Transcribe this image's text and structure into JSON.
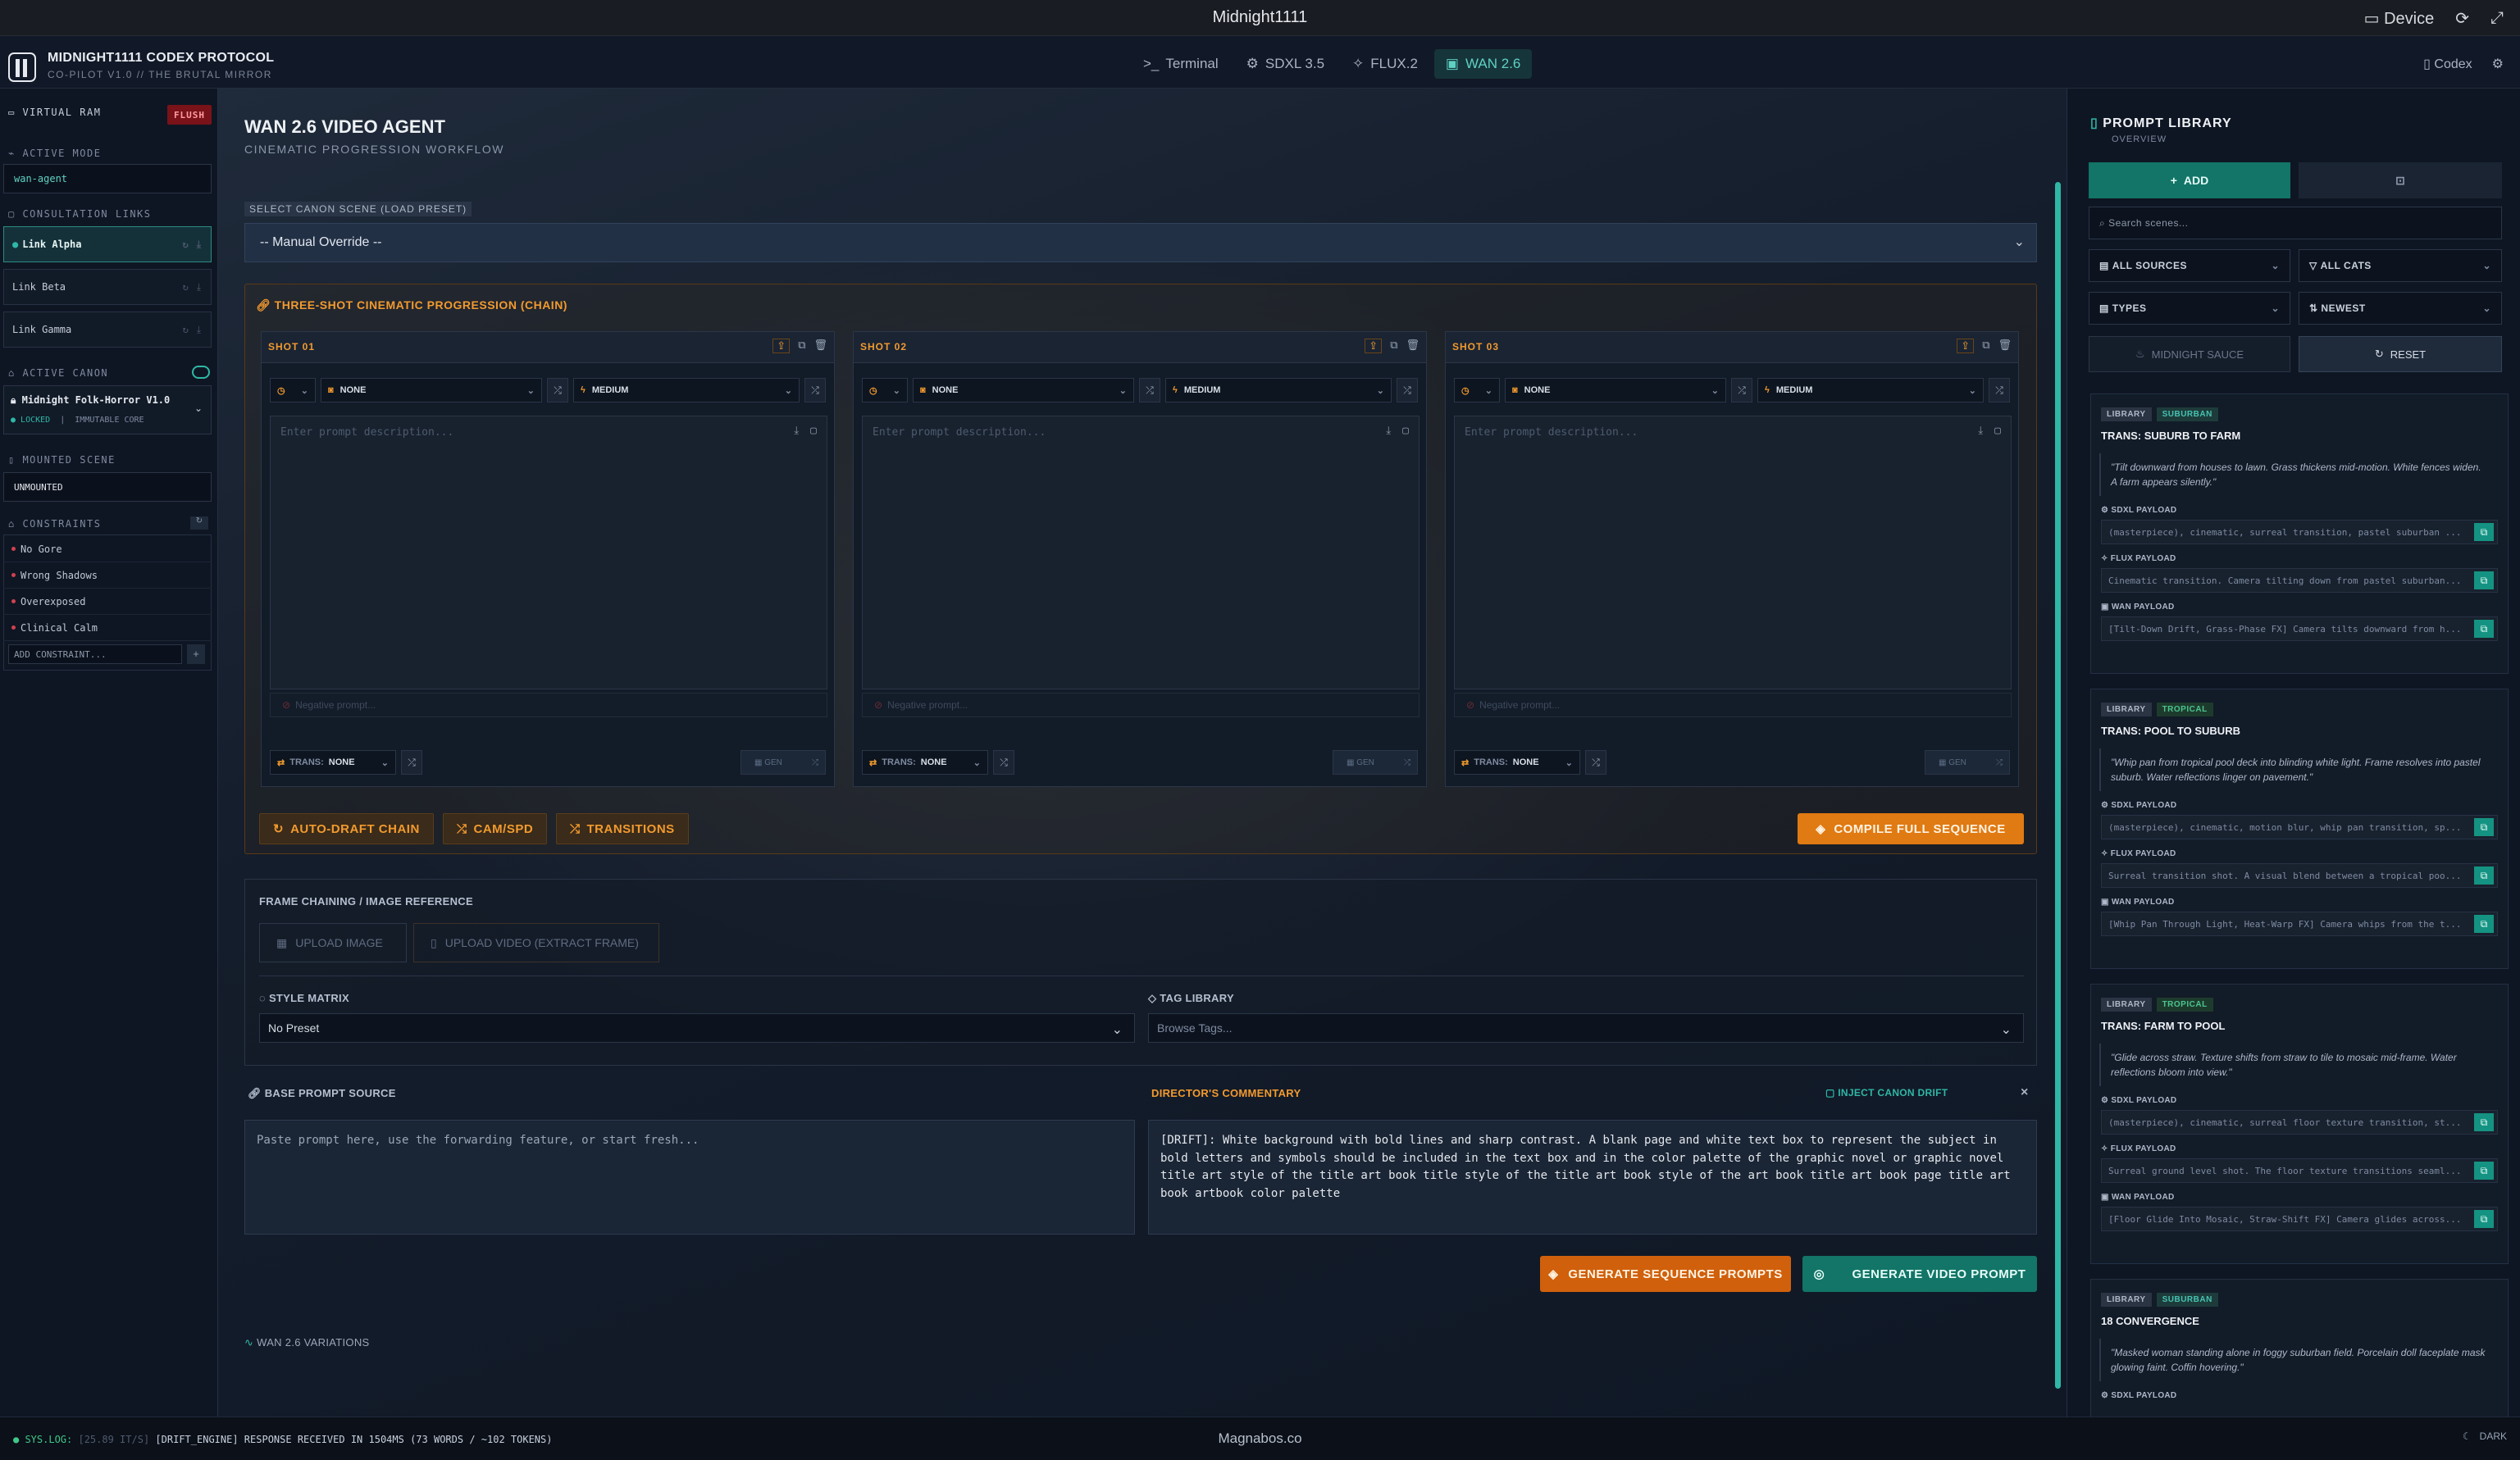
{
  "window": {
    "title": "Midnight1111",
    "device_label": "Device"
  },
  "brand": {
    "title": "MIDNIGHT1111 CODEX PROTOCOL",
    "subtitle": "CO-PILOT V1.0 // THE BRUTAL MIRROR"
  },
  "nav_tabs": [
    {
      "label": "Terminal",
      "icon": "terminal-icon"
    },
    {
      "label": "SDXL 3.5",
      "icon": "gear-icon"
    },
    {
      "label": "FLUX.2",
      "icon": "sparkle-icon"
    },
    {
      "label": "WAN 2.6",
      "icon": "video-icon",
      "active": true
    }
  ],
  "header_right": {
    "codex_label": "Codex"
  },
  "sidebar": {
    "virtual_ram_label": "VIRTUAL RAM",
    "flush_label": "FLUSH",
    "active_mode_label": "ACTIVE MODE",
    "active_mode_value": "wan-agent",
    "consultation_links_label": "CONSULTATION LINKS",
    "links": [
      "Link Alpha",
      "Link Beta",
      "Link Gamma"
    ],
    "active_canon_label": "ACTIVE CANON",
    "canon_name": "Midnight Folk-Horror V1.0",
    "canon_locked": "LOCKED",
    "canon_core": "IMMUTABLE CORE",
    "mounted_scene_label": "MOUNTED SCENE",
    "mounted_scene_value": "UNMOUNTED",
    "constraints_label": "CONSTRAINTS",
    "constraints": [
      "No Gore",
      "Wrong Shadows",
      "Overexposed",
      "Clinical Calm"
    ],
    "add_constraint_placeholder": "ADD CONSTRAINT..."
  },
  "main": {
    "title": "WAN 2.6 VIDEO AGENT",
    "subtitle": "CINEMATIC PROGRESSION WORKFLOW",
    "canon_scene_label": "SELECT CANON SCENE (LOAD PRESET)",
    "canon_scene_value": "-- Manual Override --",
    "chain_title": "THREE-SHOT CINEMATIC PROGRESSION (CHAIN)",
    "shots": [
      {
        "title": "SHOT 01",
        "type": "NONE",
        "size": "MEDIUM",
        "prompt_placeholder": "Enter prompt description...",
        "negative_placeholder": "Negative prompt...",
        "trans_label": "TRANS:",
        "trans_value": "NONE",
        "gen_label": "GEN"
      },
      {
        "title": "SHOT 02",
        "type": "NONE",
        "size": "MEDIUM",
        "prompt_placeholder": "Enter prompt description...",
        "negative_placeholder": "Negative prompt...",
        "trans_label": "TRANS:",
        "trans_value": "NONE",
        "gen_label": "GEN"
      },
      {
        "title": "SHOT 03",
        "type": "NONE",
        "size": "MEDIUM",
        "prompt_placeholder": "Enter prompt description...",
        "negative_placeholder": "Negative prompt...",
        "trans_label": "TRANS:",
        "trans_value": "NONE",
        "gen_label": "GEN"
      }
    ],
    "auto_draft_label": "AUTO-DRAFT CHAIN",
    "cam_spd_label": "CAM/SPD",
    "transitions_label": "TRANSITIONS",
    "compile_label": "COMPILE FULL SEQUENCE",
    "frame_chaining_label": "FRAME CHAINING / IMAGE REFERENCE",
    "upload_image_label": "UPLOAD IMAGE",
    "upload_video_label": "UPLOAD VIDEO (EXTRACT FRAME)",
    "style_matrix_label": "STYLE MATRIX",
    "style_matrix_value": "No Preset",
    "tag_library_label": "TAG LIBRARY",
    "tag_library_placeholder": "Browse Tags...",
    "base_prompt_label": "BASE PROMPT SOURCE",
    "base_prompt_placeholder": "Paste prompt here, use the forwarding feature, or start fresh...",
    "director_label": "DIRECTOR'S COMMENTARY",
    "inject_label": "INJECT CANON DRIFT",
    "director_text": "[DRIFT]: White background with bold lines and sharp contrast. A blank page and white text box to represent the subject in bold letters and symbols should be included in the text box and in the color palette of the graphic novel or graphic novel title art style of the title art book title style of the title art book style of the art book title art book page title art book artbook color palette",
    "generate_sequence_label": "GENERATE SEQUENCE PROMPTS",
    "generate_video_label": "GENERATE VIDEO PROMPT",
    "variations_label": "WAN 2.6 VARIATIONS"
  },
  "library": {
    "title": "PROMPT LIBRARY",
    "subtitle": "OVERVIEW",
    "add_label": "ADD",
    "search_placeholder": "Search scenes...",
    "all_sources": "ALL SOURCES",
    "all_cats": "ALL CATS",
    "types": "TYPES",
    "newest": "NEWEST",
    "midnight_sauce": "MIDNIGHT SAUCE",
    "reset": "RESET",
    "sdxl_label": "SDXL PAYLOAD",
    "flux_label": "FLUX PAYLOAD",
    "wan_label": "WAN PAYLOAD",
    "cards": [
      {
        "tag1": "LIBRARY",
        "tag2": "SUBURBAN",
        "title": "TRANS: SUBURB TO FARM",
        "quote": "\"Tilt downward from houses to lawn. Grass thickens mid-motion. White fences widen. A farm appears silently.\"",
        "sdxl": "(masterpiece), cinematic, surreal transition, pastel suburban ...",
        "flux": "Cinematic transition. Camera tilting down from pastel suburban...",
        "wan": "[Tilt-Down Drift, Grass-Phase FX] Camera tilts downward from h..."
      },
      {
        "tag1": "LIBRARY",
        "tag2": "TROPICAL",
        "title": "TRANS: POOL TO SUBURB",
        "quote": "\"Whip pan from tropical pool deck into blinding white light. Frame resolves into pastel suburb. Water reflections linger on pavement.\"",
        "sdxl": "(masterpiece), cinematic, motion blur, whip pan transition, sp...",
        "flux": "Surreal transition shot. A visual blend between a tropical poo...",
        "wan": "[Whip Pan Through Light, Heat-Warp FX] Camera whips from the t..."
      },
      {
        "tag1": "LIBRARY",
        "tag2": "TROPICAL",
        "title": "TRANS: FARM TO POOL",
        "quote": "\"Glide across straw. Texture shifts from straw to tile to mosaic mid-frame. Water reflections bloom into view.\"",
        "sdxl": "(masterpiece), cinematic, surreal floor texture transition, st...",
        "flux": "Surreal ground level shot. The floor texture transitions seaml...",
        "wan": "[Floor Glide Into Mosaic, Straw-Shift FX] Camera glides across..."
      },
      {
        "tag1": "LIBRARY",
        "tag2": "SUBURBAN",
        "title": "18 CONVERGENCE",
        "quote": "\"Masked woman standing alone in foggy suburban field. Porcelain doll faceplate mask glowing faint. Coffin hovering.\""
      }
    ]
  },
  "status": {
    "log_label": "SYS.LOG:",
    "log_meta": "[25.89 IT/S]",
    "log_text": "[DRIFT_ENGINE] RESPONSE RECEIVED IN 1504MS (73 WORDS / ~102 TOKENS)",
    "footer_brand": "Magnabos.co",
    "theme_label": "DARK"
  },
  "colors": {
    "accent_teal": "#2fb7a6",
    "accent_orange": "#e07a12",
    "danger": "#7a1219"
  }
}
